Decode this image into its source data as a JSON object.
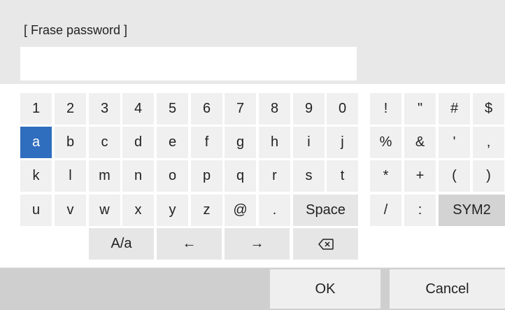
{
  "dialog": {
    "title": "[ Frase password ]",
    "input": {
      "value": "",
      "placeholder": ""
    }
  },
  "keyboard": {
    "rows": [
      [
        "1",
        "2",
        "3",
        "4",
        "5",
        "6",
        "7",
        "8",
        "9",
        "0"
      ],
      [
        "a",
        "b",
        "c",
        "d",
        "e",
        "f",
        "g",
        "h",
        "i",
        "j"
      ],
      [
        "k",
        "l",
        "m",
        "n",
        "o",
        "p",
        "q",
        "r",
        "s",
        "t"
      ],
      [
        "u",
        "v",
        "w",
        "x",
        "y",
        "z",
        "@",
        "."
      ]
    ],
    "space_label": "Space",
    "case_label": "A/a",
    "left_arrow_label": "←",
    "right_arrow_label": "→",
    "backspace_icon": "backspace-icon",
    "selected_key": "a",
    "symbol_rows": [
      [
        "!",
        "\"",
        "#",
        "$"
      ],
      [
        "%",
        "&",
        "'",
        ","
      ],
      [
        "*",
        "+",
        "(",
        ")"
      ],
      [
        "/",
        ":"
      ]
    ],
    "sym2_label": "SYM2"
  },
  "buttons": {
    "ok_label": "OK",
    "cancel_label": "Cancel"
  },
  "colors": {
    "background": "#e8e8e8",
    "key": "#f0f0f0",
    "selected_key": "#2f6dbf",
    "sym2_key": "#d3d3d3",
    "footer": "#cfcfcf"
  }
}
